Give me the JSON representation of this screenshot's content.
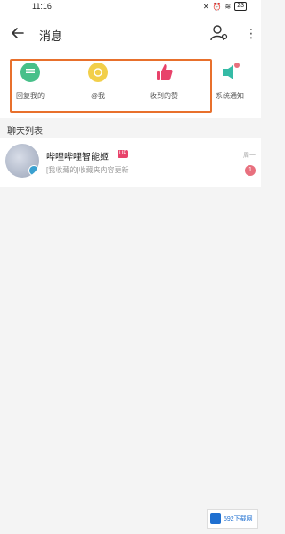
{
  "status": {
    "time": "11:16",
    "battery": "23"
  },
  "header": {
    "title": "消息"
  },
  "quick": [
    {
      "label": "回复我的",
      "color": "#48c08a",
      "icon": "chat-bubble-icon"
    },
    {
      "label": "@我",
      "color": "#f2cf4a",
      "icon": "at-icon"
    },
    {
      "label": "收到的赞",
      "color": "#e8426a",
      "icon": "thumbs-up-icon"
    },
    {
      "label": "系统通知",
      "color": "#35bba6",
      "icon": "speaker-icon"
    }
  ],
  "section": {
    "title": "聊天列表"
  },
  "chat": {
    "name": "哔哩哔哩智能姬",
    "tag": "UP",
    "message": "[我收藏的]收藏夹内容更新",
    "time": "周一",
    "unread": "1"
  },
  "watermark": {
    "text": "592下载网"
  }
}
